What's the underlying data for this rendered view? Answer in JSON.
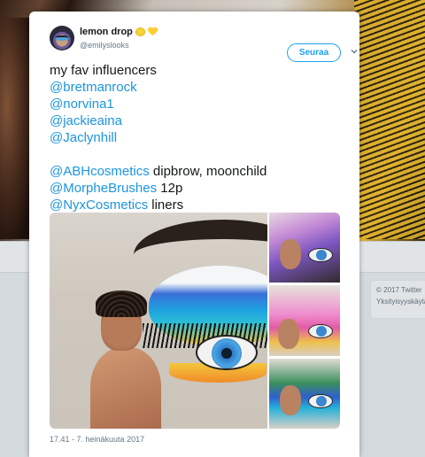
{
  "background": {
    "footer_copyright": "© 2017 Twitter",
    "footer_privacy": "Yksityisyyskäytä"
  },
  "tweet": {
    "display_name": "lemon drop",
    "name_emojis": [
      "lemon-emoji",
      "yellow-heart-emoji"
    ],
    "handle": "@emilyslooks",
    "follow_label": "Seuraa",
    "text_lines": [
      {
        "text": "my fav influencers"
      },
      {
        "mention": "@bretmanrock"
      },
      {
        "mention": "@norvina1"
      },
      {
        "mention": "@jackieaina"
      },
      {
        "mention": "@Jaclynhill"
      },
      {
        "mention": "@ABHcosmetics",
        "text": " dipbrow, moonchild"
      },
      {
        "mention": "@MorpheBrushes",
        "text": " 12p"
      },
      {
        "mention": "@NyxCosmetics",
        "text": " liners"
      }
    ],
    "timestamp": "17.41 - 7. heinäkuuta 2017"
  },
  "colors": {
    "link": "#1b95e0",
    "follow": "#1da1f2",
    "text": "#14171a",
    "muted": "#657786"
  }
}
